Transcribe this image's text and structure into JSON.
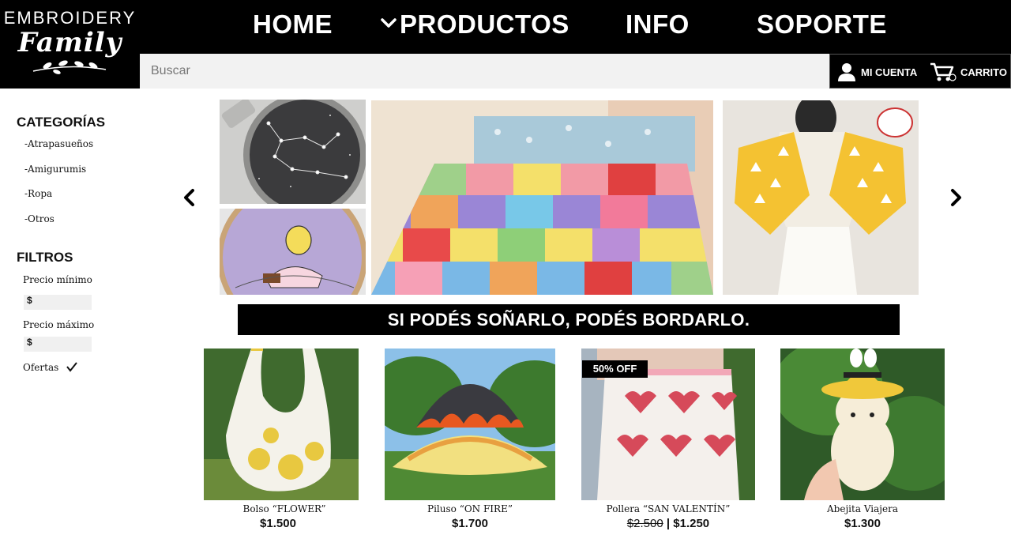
{
  "brand": {
    "line1": "EMBROIDERY",
    "line2": "Family"
  },
  "nav": {
    "home": "HOME",
    "productos": "PRODUCTOS",
    "info": "INFO",
    "soporte": "SOPORTE"
  },
  "search": {
    "placeholder": "Buscar"
  },
  "account": {
    "cuenta": "MI CUENTA",
    "carrito": "CARRITO"
  },
  "sidebar": {
    "categories_title": "CATEGORÍAS",
    "categories": [
      "-Atrapasueños",
      "-Amigurumis",
      "-Ropa",
      "-Otros"
    ],
    "filters_title": "FILTROS",
    "min_label": "Precio mínimo",
    "max_label": "Precio máximo",
    "currency": "$",
    "offers_label": "Ofertas"
  },
  "banner": "SI PODÉS SOÑARLO, PODÉS BORDARLO.",
  "products": [
    {
      "name": "Bolso “FLOWER”",
      "price": "$1.500",
      "old_price": "",
      "badge": ""
    },
    {
      "name": "Piluso “ON FIRE”",
      "price": "$1.700",
      "old_price": "",
      "badge": ""
    },
    {
      "name": "Pollera “SAN VALENTÍN”",
      "price": "$1.250",
      "old_price": "$2.500",
      "badge": "50% OFF"
    },
    {
      "name": "Abejita Viajera",
      "price": "$1.300",
      "old_price": "",
      "badge": ""
    }
  ],
  "colors": {
    "header_bg": "#000000",
    "text": "#111111",
    "search_bg": "#f2f2f2"
  }
}
